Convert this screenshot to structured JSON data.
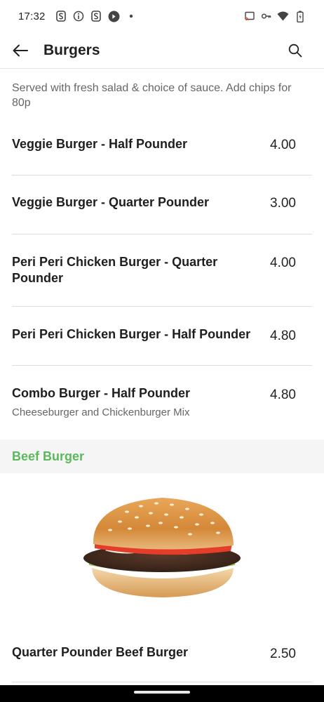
{
  "status_bar": {
    "time": "17:32",
    "left_icons": [
      "s-app-icon",
      "info-icon",
      "s-app-icon",
      "shazam-icon",
      "dot-icon"
    ],
    "right_icons": [
      "cast-icon",
      "key-icon",
      "wifi-icon",
      "battery-icon"
    ]
  },
  "app_bar": {
    "title": "Burgers"
  },
  "section": {
    "description": "Served with fresh salad & choice of sauce. Add chips for 80p"
  },
  "items": [
    {
      "name": "Veggie Burger - Half Pounder",
      "price": "4.00",
      "subtitle": ""
    },
    {
      "name": "Veggie Burger - Quarter Pounder",
      "price": "3.00",
      "subtitle": ""
    },
    {
      "name": "Peri Peri Chicken Burger - Quarter Pounder",
      "price": "4.00",
      "subtitle": ""
    },
    {
      "name": "Peri Peri Chicken Burger - Half Pounder",
      "price": "4.80",
      "subtitle": ""
    },
    {
      "name": "Combo Burger - Half Pounder",
      "price": "4.80",
      "subtitle": "Cheeseburger and Chickenburger Mix"
    }
  ],
  "category": {
    "title": "Beef Burger",
    "color": "#5cb85c"
  },
  "beef_items": [
    {
      "name": "Quarter Pounder Beef Burger",
      "price": "2.50"
    }
  ]
}
